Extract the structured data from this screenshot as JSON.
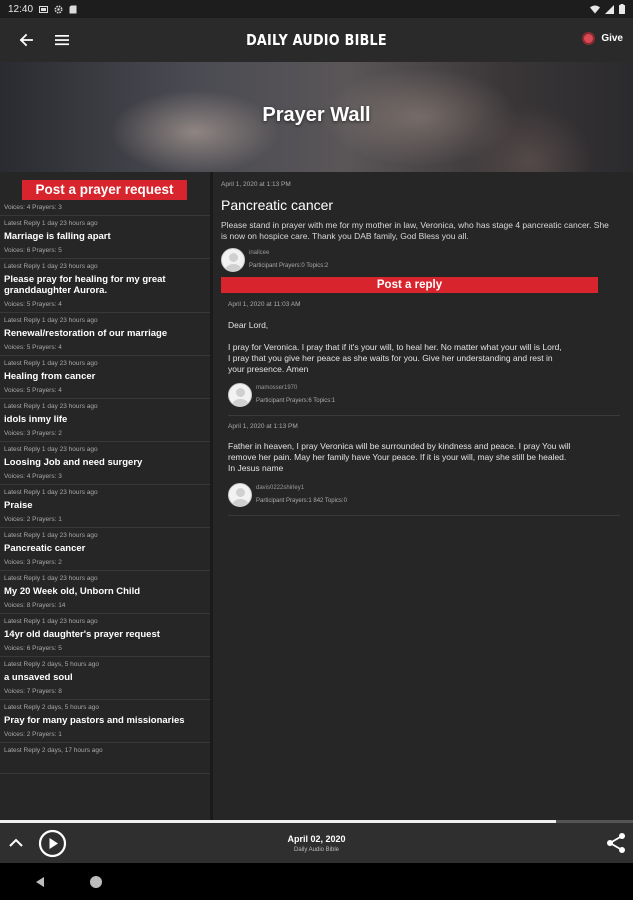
{
  "status_bar": {
    "time": "12:40"
  },
  "app_bar": {
    "title": "DAILY AUDIO BIBLE",
    "give_label": "Give"
  },
  "hero": {
    "title": "Prayer Wall"
  },
  "left_pane": {
    "post_request_label": "Post a prayer request",
    "first_meta": "Voices: 4   Prayers: 3",
    "items": [
      {
        "latest": "Latest Reply 1 day 23 hours ago",
        "title": "Marriage is falling apart",
        "meta": "Voices: 6   Prayers: 5"
      },
      {
        "latest": "Latest Reply 1 day 23 hours ago",
        "title": "Please pray for healing for my great granddaughter Aurora.",
        "meta": "Voices: 5   Prayers: 4"
      },
      {
        "latest": "Latest Reply 1 day 23 hours ago",
        "title": "Renewal/restoration of our marriage",
        "meta": "Voices: 5   Prayers: 4"
      },
      {
        "latest": "Latest Reply 1 day 23 hours ago",
        "title": "Healing from cancer",
        "meta": "Voices: 5   Prayers: 4"
      },
      {
        "latest": "Latest Reply 1 day 23 hours ago",
        "title": "idols inmy life",
        "meta": "Voices: 3   Prayers: 2"
      },
      {
        "latest": "Latest Reply 1 day 23 hours ago",
        "title": "Loosing Job and need surgery",
        "meta": "Voices: 4   Prayers: 3"
      },
      {
        "latest": "Latest Reply 1 day 23 hours ago",
        "title": "Praise",
        "meta": "Voices: 2   Prayers: 1"
      },
      {
        "latest": "Latest Reply 1 day 23 hours ago",
        "title": "Pancreatic cancer",
        "meta": "Voices: 3   Prayers: 2"
      },
      {
        "latest": "Latest Reply 1 day 23 hours ago",
        "title": "My 20 Week old, Unborn Child",
        "meta": "Voices: 8   Prayers: 14"
      },
      {
        "latest": "Latest Reply 1 day 23 hours ago",
        "title": "14yr old daughter's prayer request",
        "meta": "Voices: 6   Prayers: 5"
      },
      {
        "latest": "Latest Reply 2 days, 5 hours ago",
        "title": "a unsaved soul",
        "meta": "Voices: 7   Prayers: 8"
      },
      {
        "latest": "Latest Reply 2 days, 5 hours ago",
        "title": "Pray for many pastors and missionaries",
        "meta": "Voices: 2   Prayers: 1"
      },
      {
        "latest": "Latest Reply 2 days, 17 hours ago",
        "title": "",
        "meta": ""
      }
    ]
  },
  "detail": {
    "date": "April 1, 2020 at 1:13 PM",
    "title": "Pancreatic cancer",
    "body": "Please stand in prayer with me for my mother in law, Veronica, who has stage 4 pancreatic cancer. She is now on hospice care. Thank you DAB family, God Bless you all.",
    "author": {
      "name": "inallcee",
      "stats": "Participant   Prayers:0   Topics:2"
    },
    "post_reply_label": "Post a reply",
    "replies": [
      {
        "date": "April 1, 2020 at 11:03 AM",
        "lines": [
          "Dear Lord,",
          "",
          "I pray for Veronica.  I pray that if it's your will, to heal her.  No matter what your will is Lord,",
          "I pray that you give her peace as she waits for you.  Give her understanding and rest in",
          "your presence.  Amen"
        ],
        "author": {
          "name": "mamosser1970",
          "stats": "Participant   Prayers:6   Topics:1"
        }
      },
      {
        "date": "April 1, 2020 at 1:13 PM",
        "lines": [
          "Father in heaven, I pray Veronica will be surrounded by kindness and peace. I pray You will",
          "remove her pain. May her family have Your peace. If it is your will, may she still be healed.",
          "In Jesus name"
        ],
        "author": {
          "name": "davis0222shirley1",
          "stats": "Participant   Prayers:1 842   Topics:0"
        }
      }
    ]
  },
  "player": {
    "progress_fraction": 0.878,
    "date": "April 02, 2020",
    "subtitle": "Daily Audio Bible"
  },
  "colors": {
    "accent_red": "#d8252d",
    "background": "#262626",
    "app_bar": "#2a2a2a"
  }
}
